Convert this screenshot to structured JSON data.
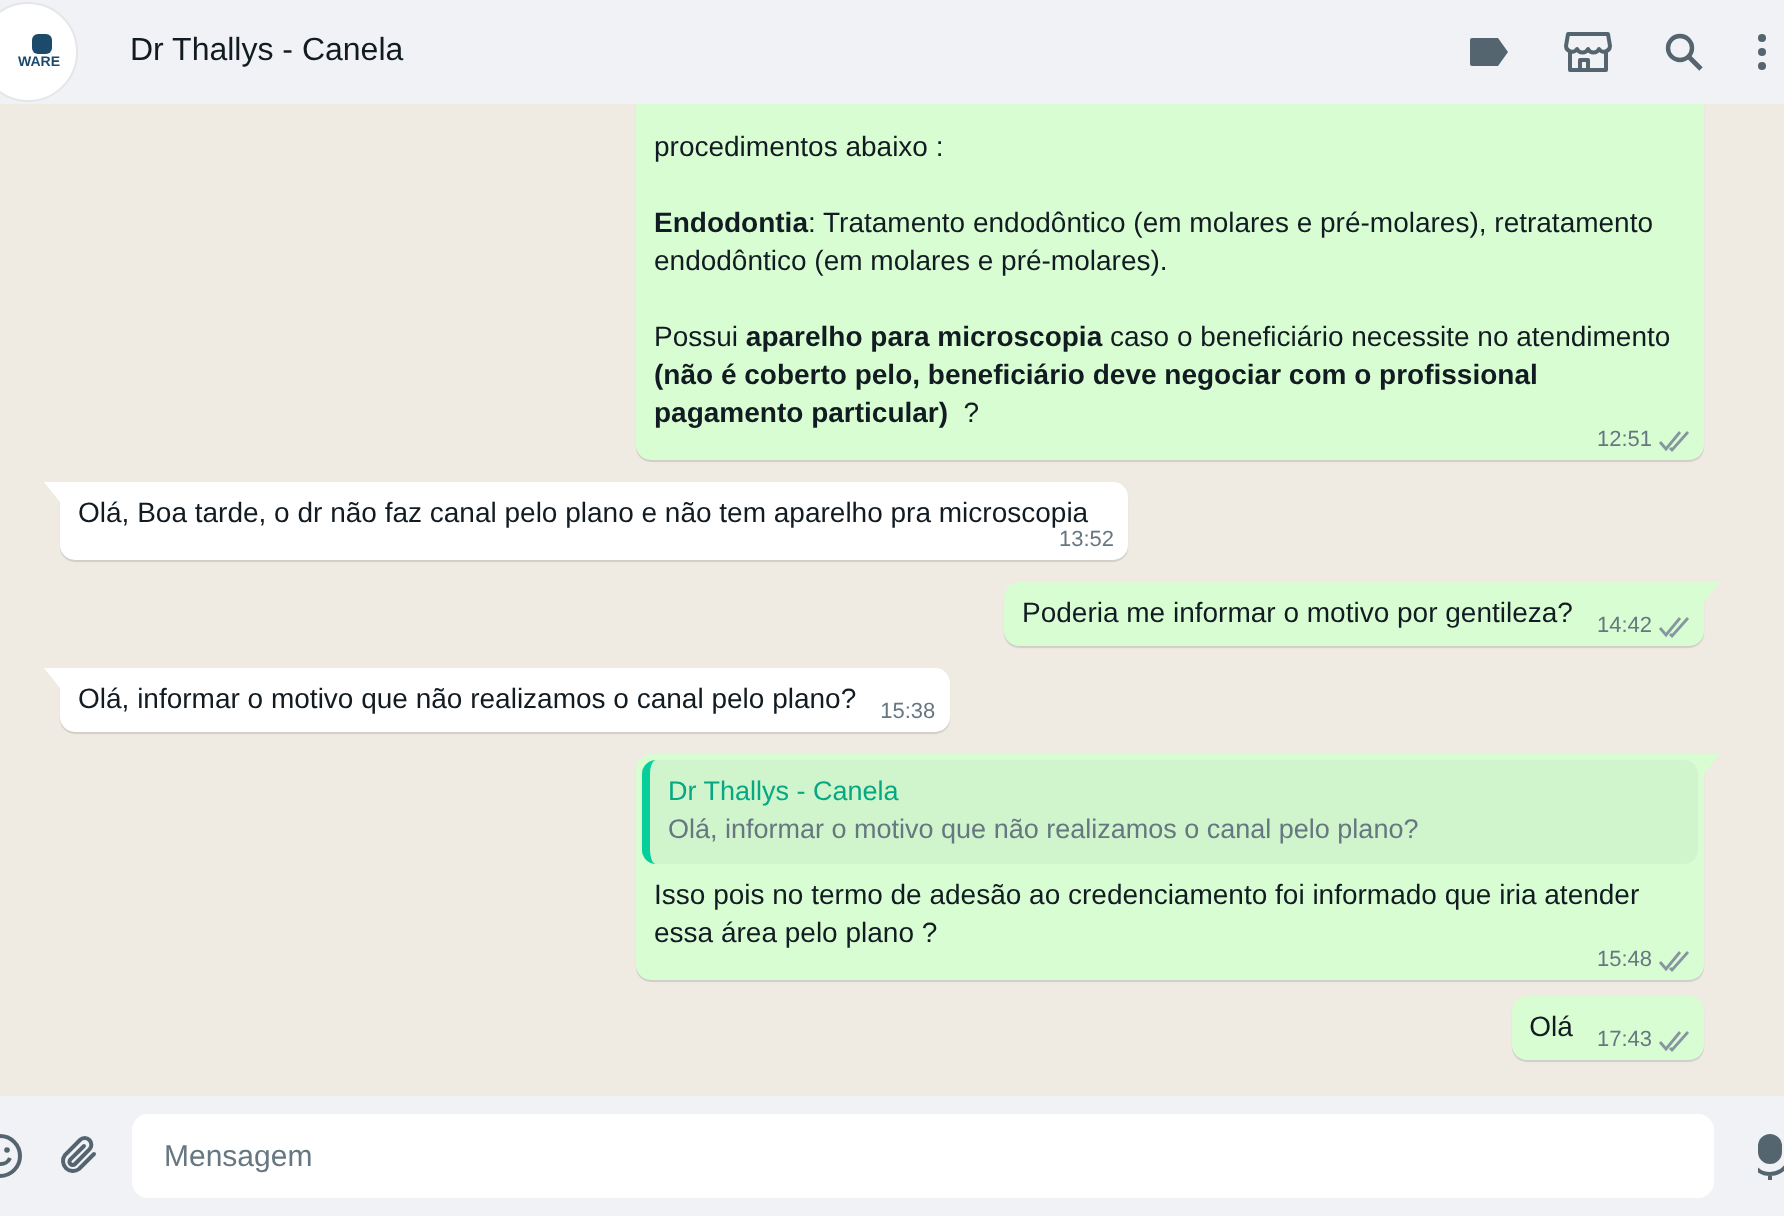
{
  "header": {
    "avatar_text": "WARE",
    "title": "Dr Thallys - Canela"
  },
  "messages": [
    {
      "from_me": true,
      "tail": false,
      "text": "procedimentos abaixo :\n\n**Endodontia**: Tratamento endodôntico (em molares e pré-molares), retratamento endodôntico (em molares e pré-molares).\n\nPossui **aparelho para microscopia** caso o beneficiário necessite no atendimento **(não é coberto pelo, beneficiário deve negociar com o profissional pagamento particular)**  ?",
      "time": "12:51",
      "read": false
    },
    {
      "from_me": false,
      "tail": true,
      "text": "Olá, Boa tarde, o dr não faz canal pelo plano e não tem aparelho pra microscopia",
      "time": "13:52"
    },
    {
      "from_me": true,
      "tail": true,
      "text": "Poderia me informar o motivo por gentileza?",
      "time": "14:42",
      "read": false
    },
    {
      "from_me": false,
      "tail": true,
      "text": "Olá, informar o motivo que não realizamos o canal pelo plano?",
      "time": "15:38"
    },
    {
      "from_me": true,
      "tail": true,
      "quote": {
        "author": "Dr Thallys - Canela",
        "text": "Olá, informar o motivo que não realizamos o canal pelo plano?"
      },
      "text": "Isso pois no termo de adesão ao credenciamento foi informado que iria atender essa área pelo plano ?",
      "time": "15:48",
      "read": false
    },
    {
      "from_me": true,
      "tail": false,
      "text": "Olá",
      "time": "17:43",
      "read": false
    }
  ],
  "composer": {
    "placeholder": "Mensagem"
  }
}
